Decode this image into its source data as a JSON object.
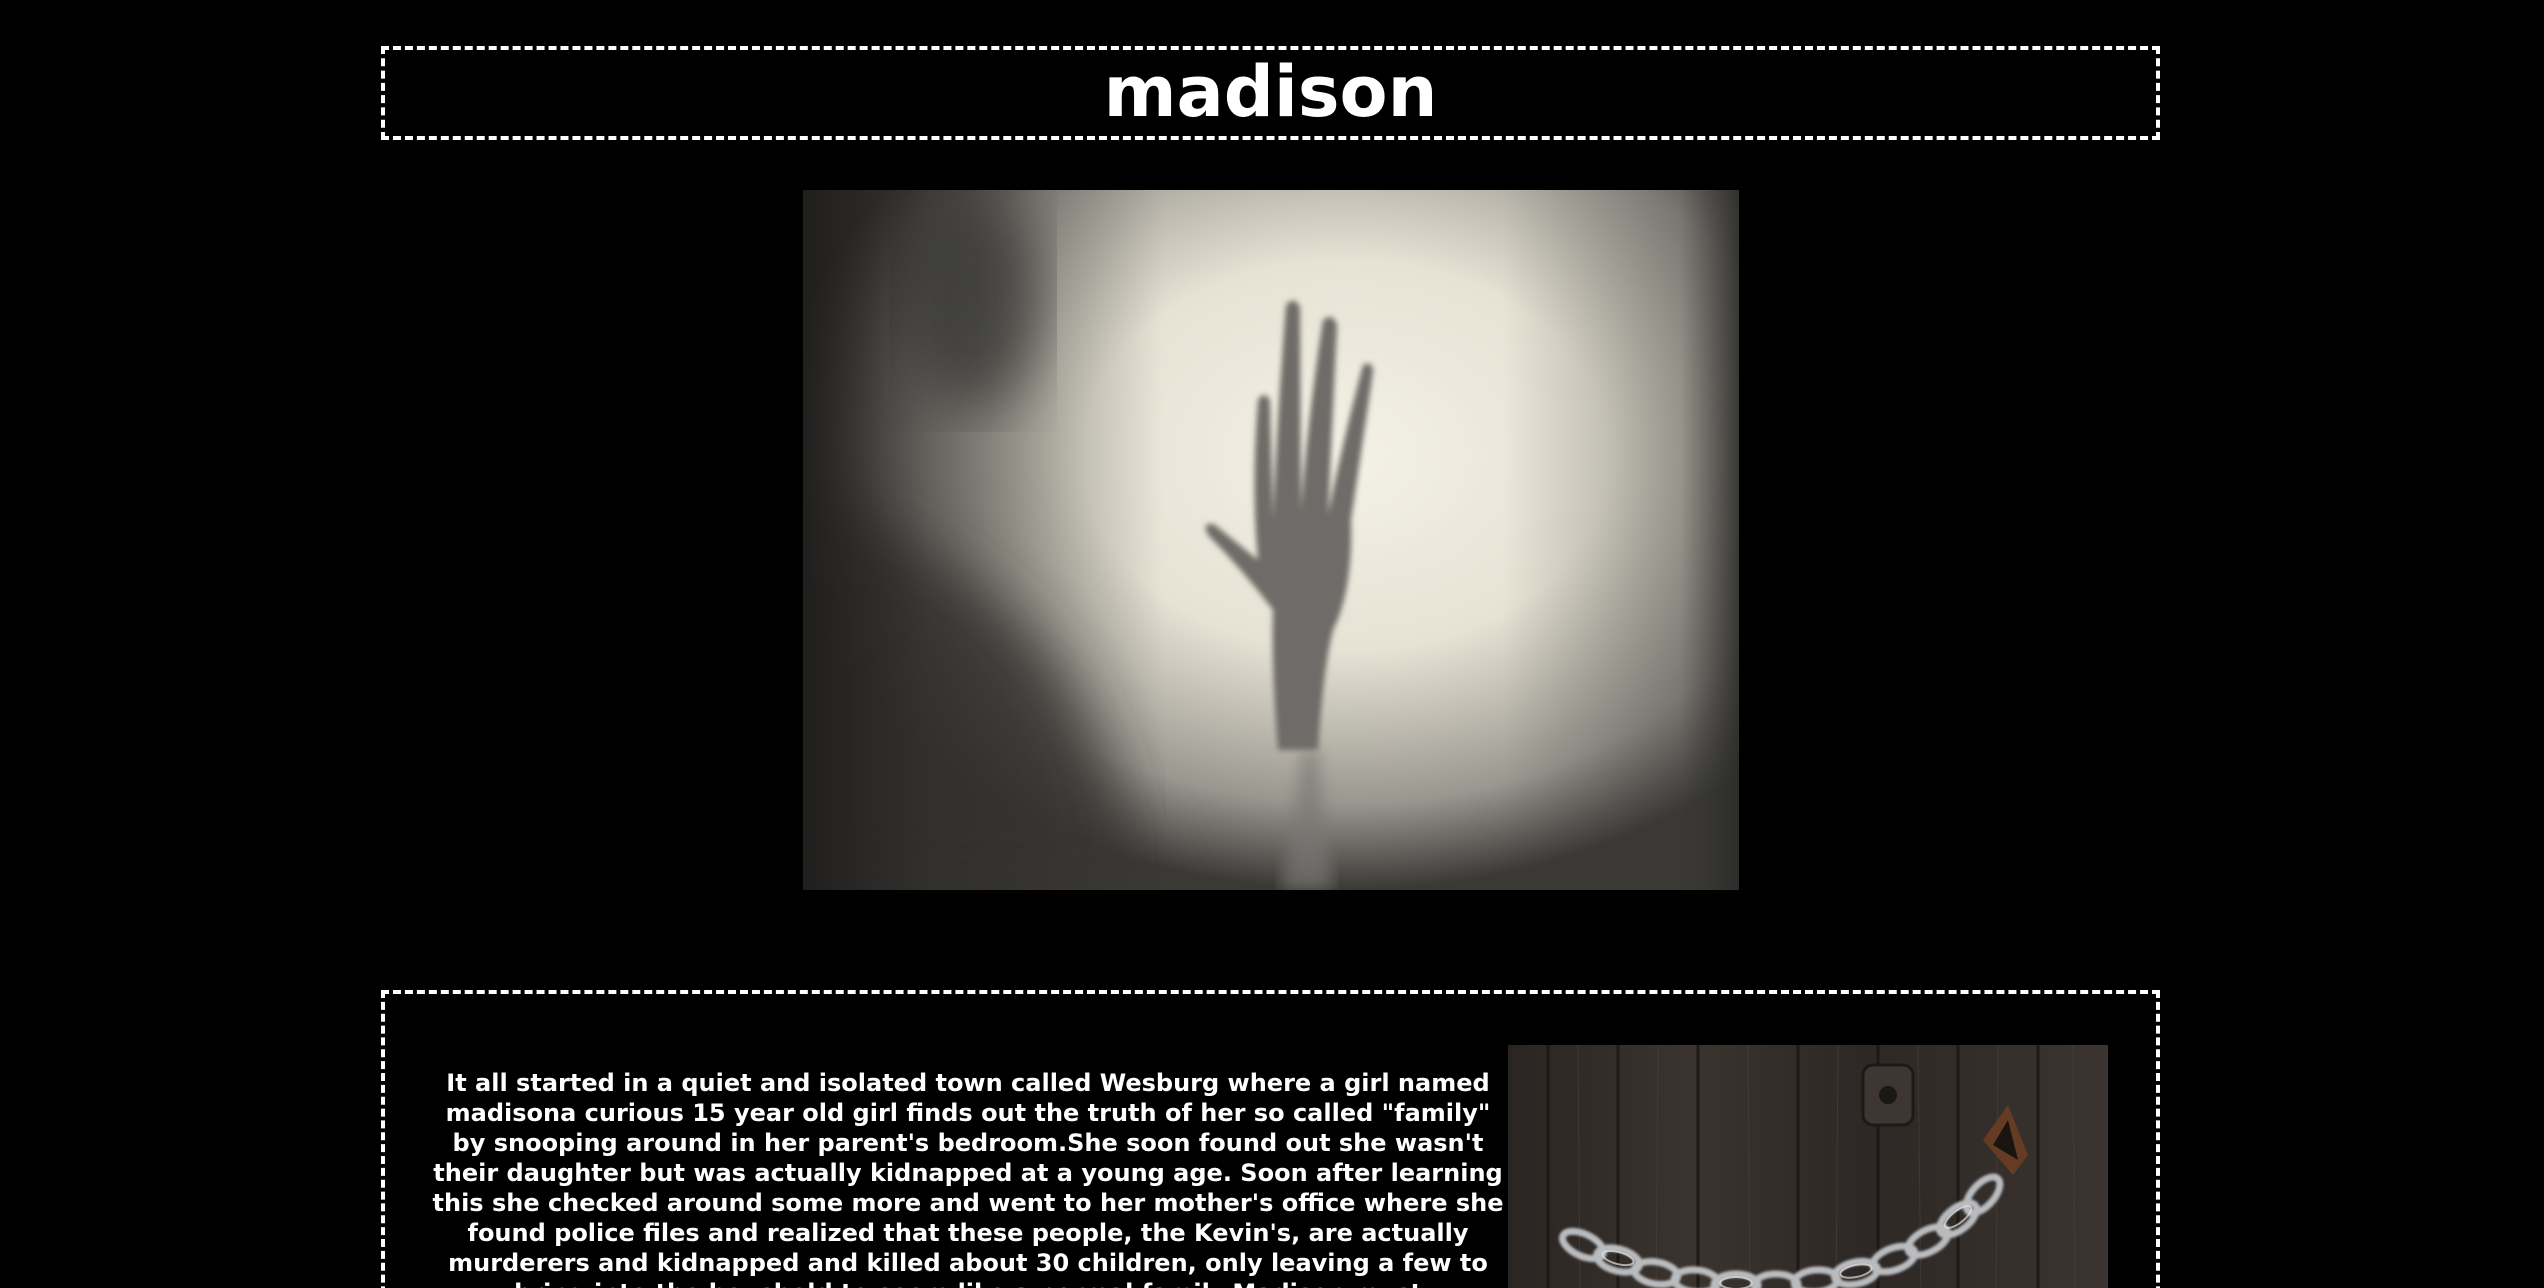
{
  "header": {
    "title": "madison"
  },
  "hero_image": {
    "description_icon": "hand-behind-frosted-glass-image"
  },
  "story": {
    "text": "It all started in a quiet and isolated town called Wesburg where a girl named madisona curious 15 year old girl finds out the truth of her so called \"family\" by snooping around in her parent's bedroom.She soon found out she wasn't their daughter but was actually kidnapped at a young age. Soon after learning this she checked around some more and went to her mother's office where she found police files and realized that these people, the Kevin's, are actually murderers and kidnapped and killed about 30 children, only leaving a few to bring into the houshold to seem like a normal family.Madison must",
    "side_image_icon": "chained-wooden-door-image"
  },
  "colors": {
    "background": "#000000",
    "text": "#ffffff",
    "border": "#ffffff"
  }
}
